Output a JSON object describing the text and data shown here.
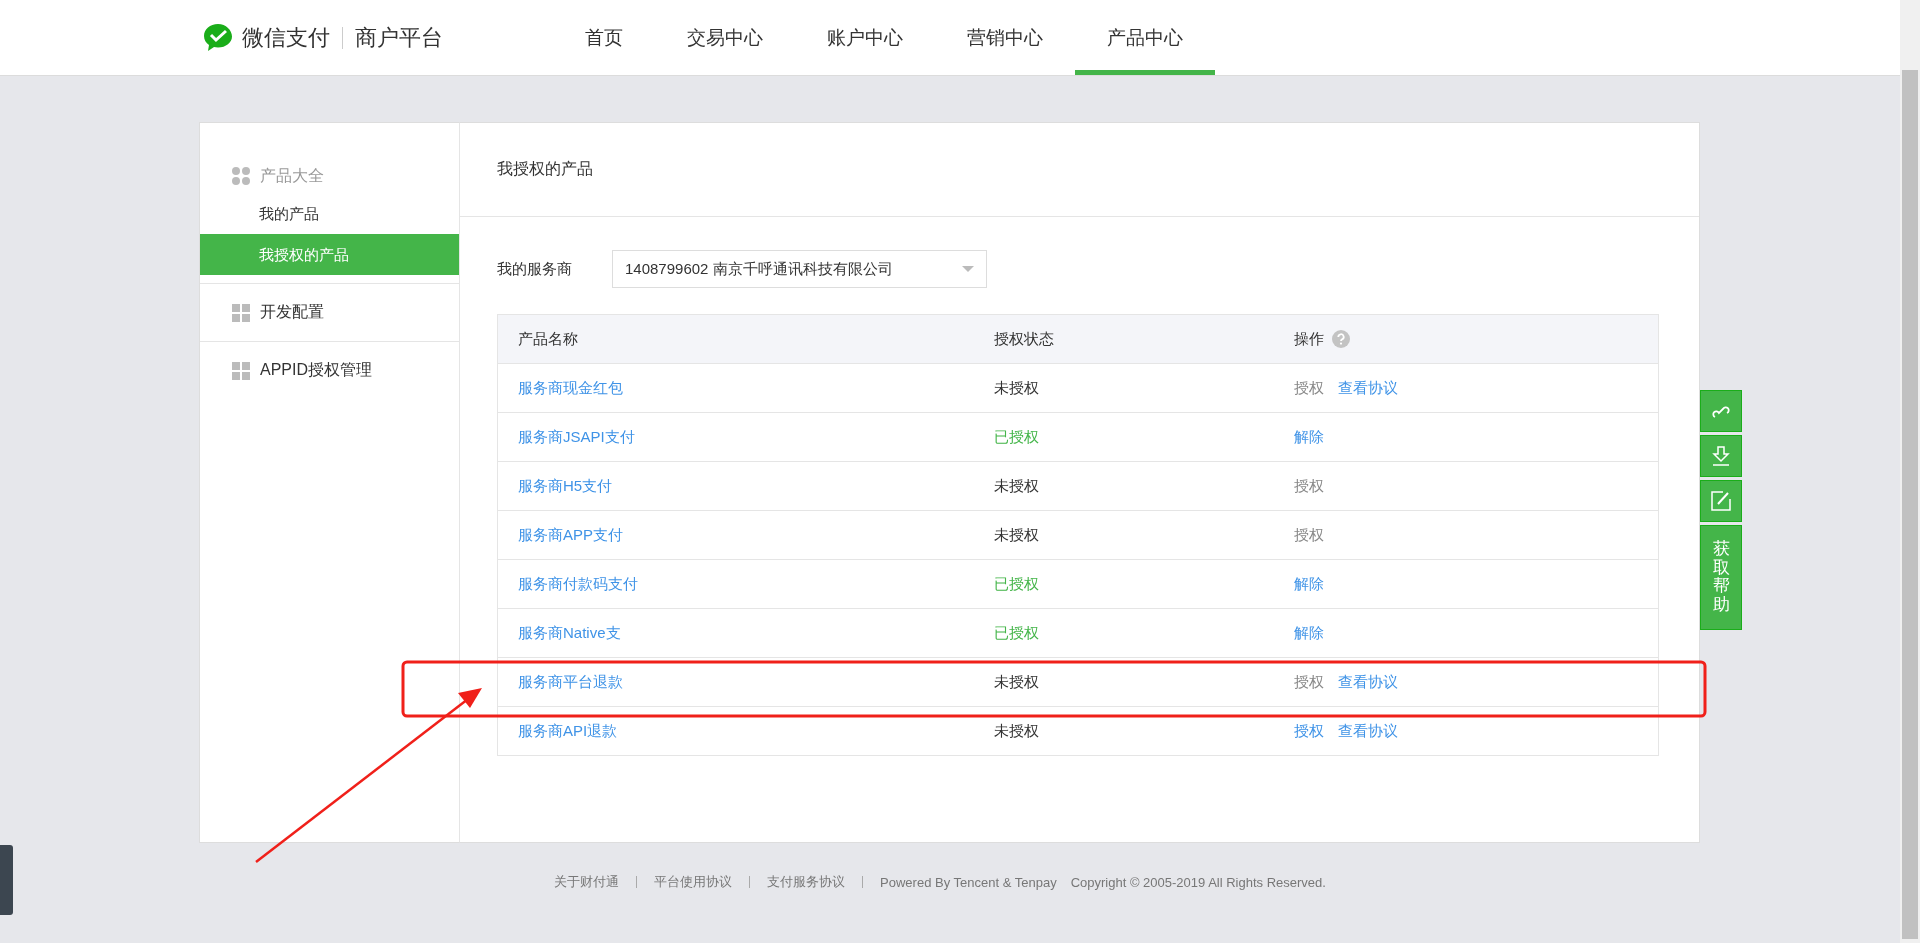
{
  "header": {
    "brand": "微信支付",
    "product": "商户平台",
    "nav": [
      {
        "label": "首页",
        "selected": false
      },
      {
        "label": "交易中心",
        "selected": false
      },
      {
        "label": "账户中心",
        "selected": false
      },
      {
        "label": "营销中心",
        "selected": false
      },
      {
        "label": "产品中心",
        "selected": true
      }
    ]
  },
  "sidebar": {
    "groups": [
      {
        "label": "产品大全",
        "expanded": true,
        "children": [
          {
            "label": "我的产品",
            "selected": false
          },
          {
            "label": "我授权的产品",
            "selected": true
          }
        ]
      },
      {
        "label": "开发配置",
        "expanded": false
      },
      {
        "label": "APPID授权管理",
        "expanded": false
      }
    ]
  },
  "content": {
    "title": "我授权的产品",
    "provider_label": "我的服务商",
    "provider_value": "1408799602 南京千呼通讯科技有限公司",
    "table": {
      "columns": [
        "产品名称",
        "授权状态",
        "操作"
      ],
      "rows": [
        {
          "name": "服务商现金红包",
          "status": {
            "text": "未授权",
            "authorized": false
          },
          "actions": [
            {
              "label": "授权",
              "disabled": true
            },
            {
              "label": "查看协议",
              "disabled": false
            }
          ]
        },
        {
          "name": "服务商JSAPI支付",
          "status": {
            "text": "已授权",
            "authorized": true
          },
          "actions": [
            {
              "label": "解除",
              "disabled": false
            }
          ]
        },
        {
          "name": "服务商H5支付",
          "status": {
            "text": "未授权",
            "authorized": false
          },
          "actions": [
            {
              "label": "授权",
              "disabled": true
            }
          ]
        },
        {
          "name": "服务商APP支付",
          "status": {
            "text": "未授权",
            "authorized": false
          },
          "actions": [
            {
              "label": "授权",
              "disabled": true
            }
          ]
        },
        {
          "name": "服务商付款码支付",
          "status": {
            "text": "已授权",
            "authorized": true
          },
          "actions": [
            {
              "label": "解除",
              "disabled": false
            }
          ]
        },
        {
          "name": "服务商Native支",
          "status": {
            "text": "已授权",
            "authorized": true
          },
          "actions": [
            {
              "label": "解除",
              "disabled": false
            }
          ]
        },
        {
          "name": "服务商平台退款",
          "status": {
            "text": "未授权",
            "authorized": false
          },
          "actions": [
            {
              "label": "授权",
              "disabled": true
            },
            {
              "label": "查看协议",
              "disabled": false
            }
          ]
        },
        {
          "name": "服务商API退款",
          "status": {
            "text": "未授权",
            "authorized": false
          },
          "actions": [
            {
              "label": "授权",
              "disabled": false
            },
            {
              "label": "查看协议",
              "disabled": false
            }
          ]
        }
      ]
    }
  },
  "float_tools": {
    "help_label": "获取帮助"
  },
  "footer": {
    "links": [
      "关于财付通",
      "平台使用协议",
      "支付服务协议"
    ],
    "powered": "Powered By Tencent & Tenpay",
    "copyright": "Copyright © 2005-2019 All Rights Reserved."
  }
}
